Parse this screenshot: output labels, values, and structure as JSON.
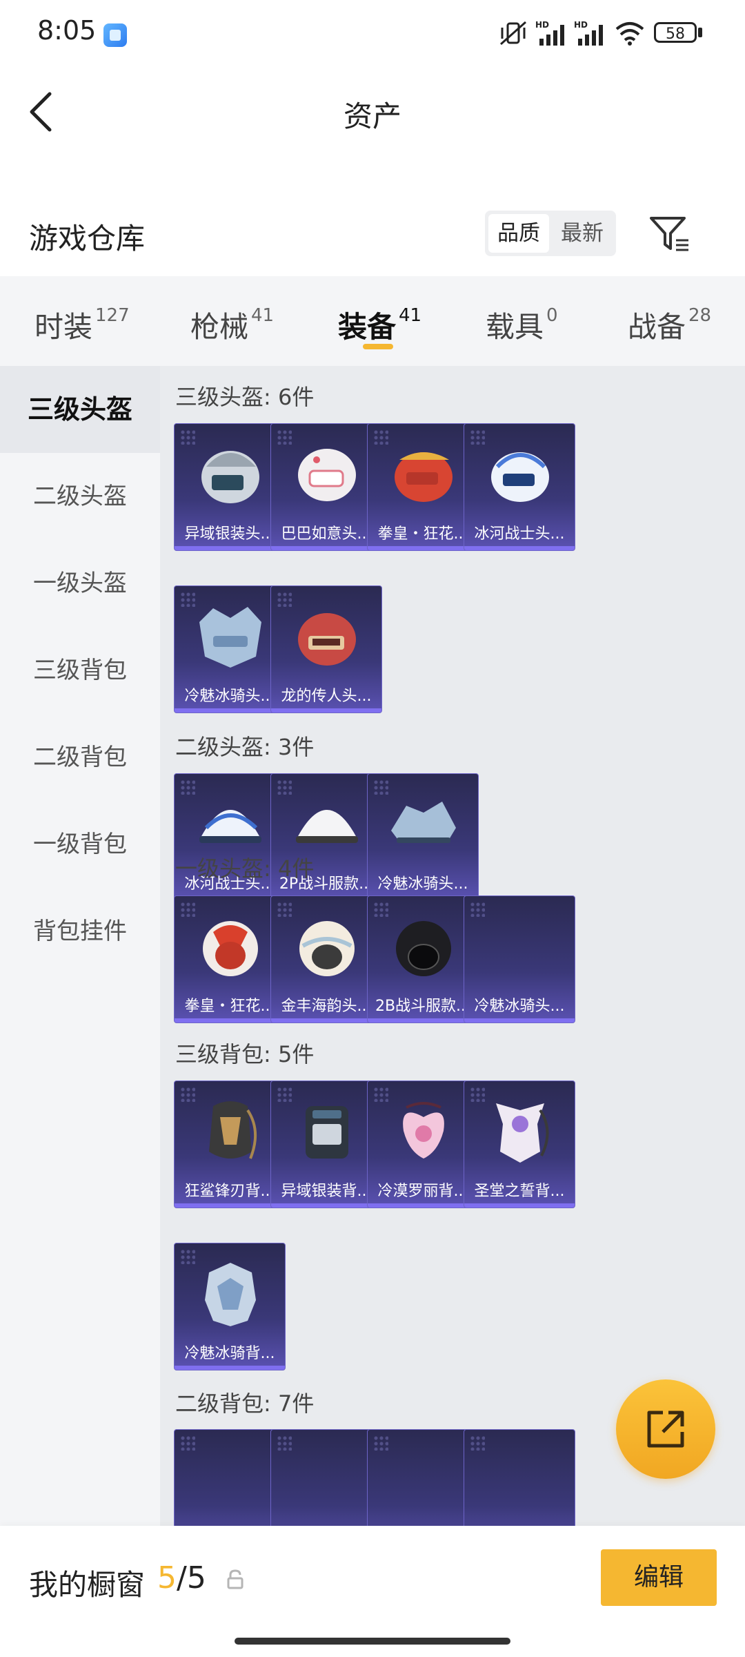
{
  "status_bar": {
    "time": "8:05",
    "battery": "58",
    "icons": [
      "app-icon",
      "vibrate-off-icon",
      "hd-signal-icon",
      "hd-signal-icon",
      "wifi-icon",
      "battery-icon"
    ]
  },
  "header": {
    "title": "资产",
    "back_icon": "chevron-left-icon"
  },
  "warehouse": {
    "title": "游戏仓库",
    "sort_options": [
      "品质",
      "最新"
    ],
    "selected_sort": "品质",
    "filter_icon": "filter-icon"
  },
  "tabs": [
    {
      "label": "时装",
      "count": "127"
    },
    {
      "label": "枪械",
      "count": "41"
    },
    {
      "label": "装备",
      "count": "41"
    },
    {
      "label": "载具",
      "count": "0"
    },
    {
      "label": "战备",
      "count": "28"
    }
  ],
  "active_tab": "装备",
  "sidebar": {
    "items": [
      "三级头盔",
      "二级头盔",
      "一级头盔",
      "三级背包",
      "二级背包",
      "一级背包",
      "背包挂件"
    ],
    "active": "三级头盔"
  },
  "sections": [
    {
      "title": "三级头盔: 6件",
      "items": [
        "异域银装头...",
        "巴巴如意头...",
        "拳皇・狂花...",
        "冰河战士头...",
        "冷魅冰骑头...",
        "龙的传人头..."
      ]
    },
    {
      "title": "二级头盔: 3件",
      "items": [
        "冰河战士头...",
        "2P战斗服款...",
        "冷魅冰骑头..."
      ]
    },
    {
      "title": "一级头盔: 4件",
      "items": [
        "拳皇・狂花...",
        "金丰海韵头...",
        "2B战斗服款...",
        "冷魅冰骑头..."
      ]
    },
    {
      "title": "三级背包: 5件",
      "items": [
        "狂鲨锋刃背...",
        "异域银装背...",
        "冷漠罗丽背...",
        "圣堂之誓背...",
        "冷魅冰骑背..."
      ]
    },
    {
      "title": "二级背包: 7件",
      "items": []
    }
  ],
  "fab": {
    "icon": "share-external-icon"
  },
  "showcase": {
    "title": "我的橱窗",
    "used": "5",
    "separator": "/",
    "total": "5",
    "lock_icon": "lock-icon",
    "edit_label": "编辑"
  },
  "colors": {
    "accent": "#f5b731",
    "card_top": "#2b2a52",
    "card_bottom": "#5b52b3"
  }
}
